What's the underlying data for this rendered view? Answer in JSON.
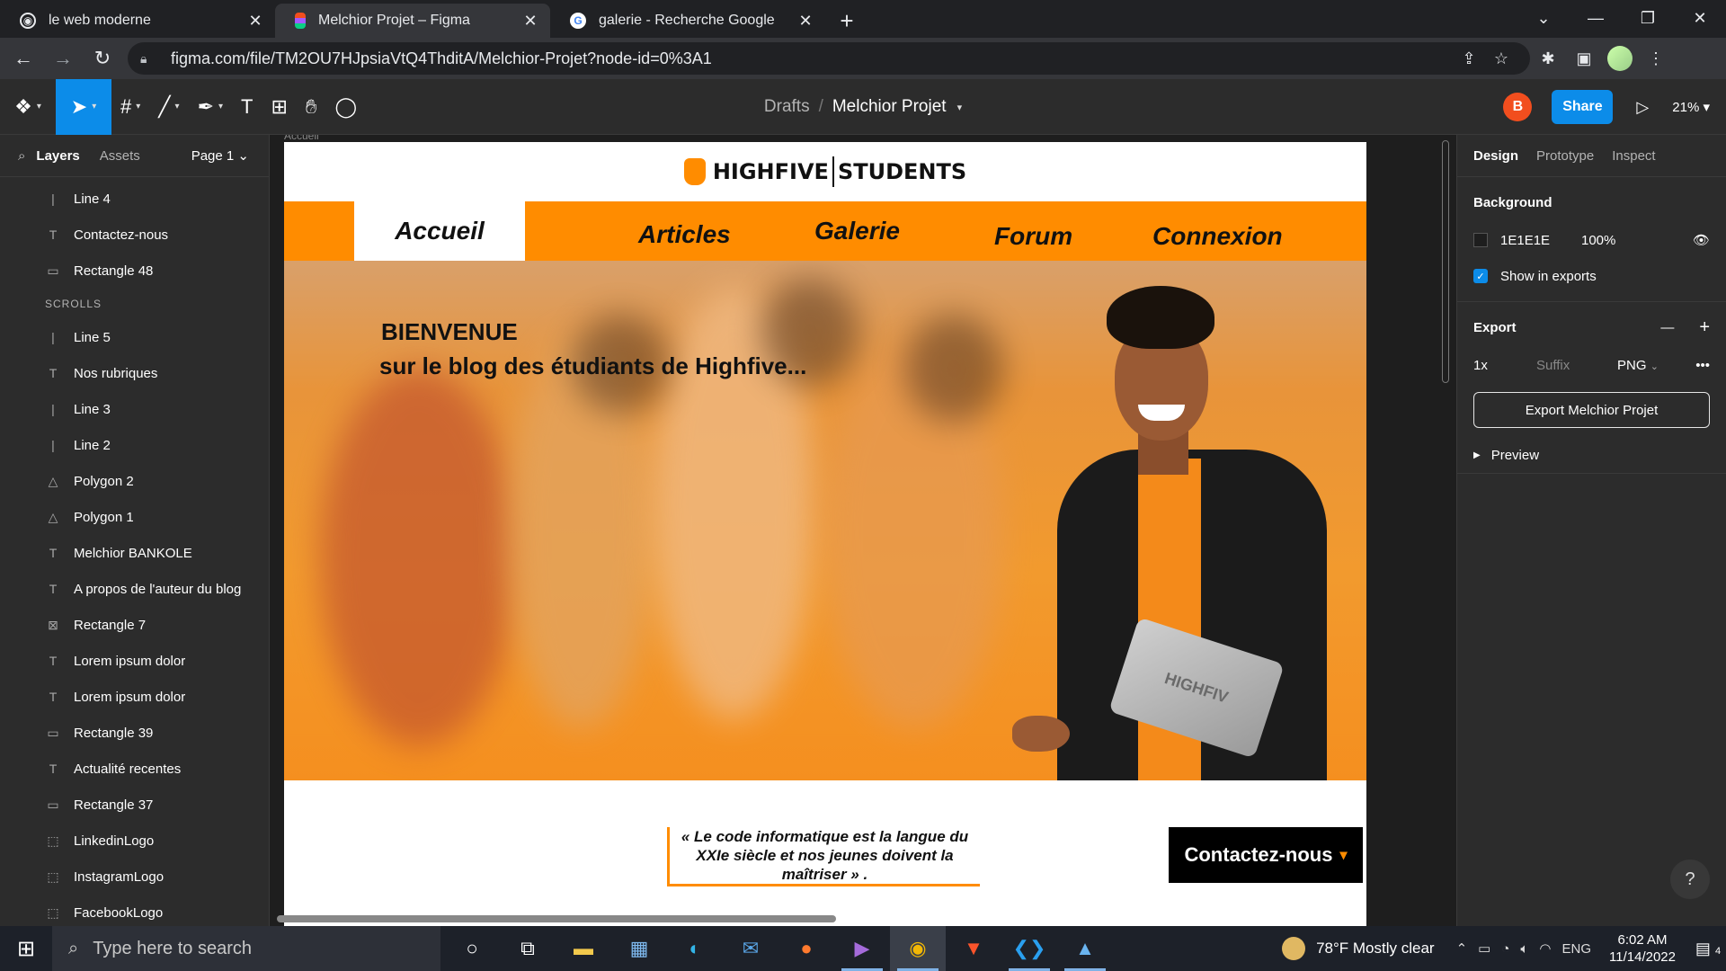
{
  "browser": {
    "tabs": [
      {
        "title": "le web moderne",
        "icon": "globe-icon",
        "active": false
      },
      {
        "title": "Melchior Projet – Figma",
        "icon": "figma-icon",
        "active": true
      },
      {
        "title": "galerie - Recherche Google",
        "icon": "google-icon",
        "active": false
      }
    ],
    "url": "figma.com/file/TM2OU7HJpsiaVtQ4ThditA/Melchior-Projet?node-id=0%3A1"
  },
  "toolbar": {
    "breadcrumb_parent": "Drafts",
    "breadcrumb_sep": "/",
    "file_name": "Melchior Projet",
    "user_initial": "B",
    "share_label": "Share",
    "zoom": "21%"
  },
  "left_panel": {
    "tab_layers": "Layers",
    "tab_assets": "Assets",
    "page": "Page 1",
    "layers": [
      {
        "name": "Line 4",
        "icon": "line-icon"
      },
      {
        "name": "Contactez-nous",
        "icon": "text-icon"
      },
      {
        "name": "Rectangle 48",
        "icon": "rectangle-icon"
      },
      {
        "name": "SCROLLS",
        "icon": "",
        "section": true
      },
      {
        "name": "Line 5",
        "icon": "line-icon"
      },
      {
        "name": "Nos rubriques",
        "icon": "text-icon"
      },
      {
        "name": "Line 3",
        "icon": "line-icon"
      },
      {
        "name": "Line 2",
        "icon": "line-icon"
      },
      {
        "name": "Polygon 2",
        "icon": "polygon-icon"
      },
      {
        "name": "Polygon 1",
        "icon": "polygon-icon"
      },
      {
        "name": "Melchior BANKOLE",
        "icon": "text-icon"
      },
      {
        "name": "A propos de l'auteur du blog",
        "icon": "text-icon"
      },
      {
        "name": "Rectangle 7",
        "icon": "image-icon"
      },
      {
        "name": "Lorem ipsum dolor",
        "icon": "text-icon"
      },
      {
        "name": "Lorem ipsum dolor",
        "icon": "text-icon"
      },
      {
        "name": "Rectangle 39",
        "icon": "rectangle-icon"
      },
      {
        "name": "Actualité recentes",
        "icon": "text-icon"
      },
      {
        "name": "Rectangle 37",
        "icon": "rectangle-icon"
      },
      {
        "name": "LinkedinLogo",
        "icon": "frame-icon"
      },
      {
        "name": "InstagramLogo",
        "icon": "frame-icon"
      },
      {
        "name": "FacebookLogo",
        "icon": "frame-icon"
      }
    ]
  },
  "canvas": {
    "frame_label": "Accueil",
    "logo_left": "HIGHFIVE",
    "logo_right": "STUDENTS",
    "nav": [
      "Accueil",
      "Articles",
      "Galerie",
      "Forum",
      "Connexion"
    ],
    "hero_title": "BIENVENUE",
    "hero_subtitle": "sur le blog des étudiants  de Highfive...",
    "laptop_text": "HIGHFIV",
    "quote": "« Le code informatique est la langue du XXIe siècle et nos jeunes doivent la maîtriser » .",
    "contact_label": "Contactez-nous",
    "contact_arrow": "▾",
    "accent_color": "#ff8c00"
  },
  "right_panel": {
    "tabs": [
      "Design",
      "Prototype",
      "Inspect"
    ],
    "background_title": "Background",
    "bg_hex": "1E1E1E",
    "bg_opacity": "100%",
    "show_in_exports": "Show in exports",
    "export_title": "Export",
    "export_scale": "1x",
    "export_suffix_placeholder": "Suffix",
    "export_format": "PNG",
    "export_button": "Export Melchior Projet",
    "preview_label": "Preview",
    "help": "?"
  },
  "taskbar": {
    "search_placeholder": "Type here to search",
    "weather": "78°F  Mostly clear",
    "lang": "ENG",
    "time": "6:02 AM",
    "date": "11/14/2022",
    "notif_count": "4"
  }
}
